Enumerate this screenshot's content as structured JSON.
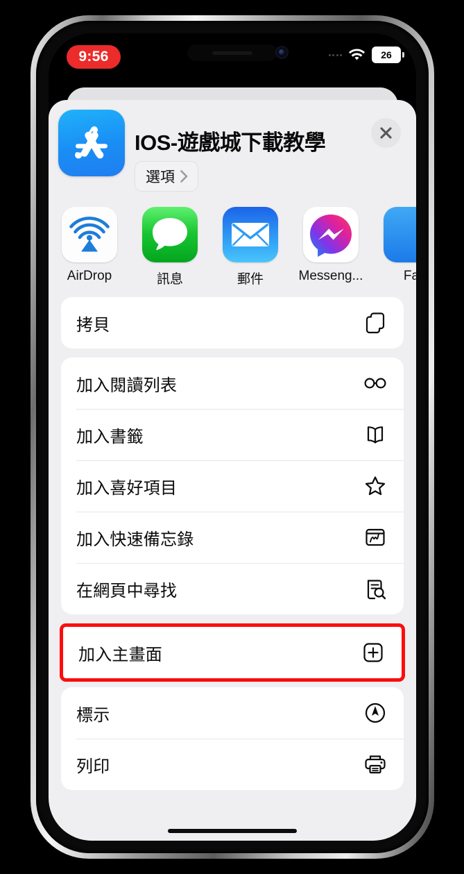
{
  "status_bar": {
    "time": "9:56",
    "battery_level": "26",
    "wifi_icon": "wifi-icon",
    "signal_icon": "signal-dots-icon",
    "clock_badge_color": "#ec2b2b"
  },
  "share_sheet": {
    "title": "IOS-遊戲城下載教學",
    "app_icon_name": "app-store-icon",
    "options_label": "選項",
    "options_chevron_icon": "chevron-right-icon",
    "close_icon": "close-icon",
    "apps": [
      {
        "label": "AirDrop",
        "icon": "airdrop-icon"
      },
      {
        "label": "訊息",
        "icon": "messages-icon"
      },
      {
        "label": "郵件",
        "icon": "mail-icon"
      },
      {
        "label": "Messeng...",
        "icon": "messenger-icon"
      },
      {
        "label": "Fa",
        "icon": "facetime-icon"
      }
    ],
    "action_groups": [
      {
        "rows": [
          {
            "label": "拷貝",
            "icon": "copy-icon",
            "highlighted": false
          }
        ]
      },
      {
        "rows": [
          {
            "label": "加入閱讀列表",
            "icon": "glasses-icon",
            "highlighted": false
          },
          {
            "label": "加入書籤",
            "icon": "book-icon",
            "highlighted": false
          },
          {
            "label": "加入喜好項目",
            "icon": "star-icon",
            "highlighted": false
          },
          {
            "label": "加入快速備忘錄",
            "icon": "quick-note-icon",
            "highlighted": false
          },
          {
            "label": "在網頁中尋找",
            "icon": "find-on-page-icon",
            "highlighted": false
          }
        ]
      },
      {
        "highlighted": true,
        "highlight_color": "#fc0d0d",
        "rows": [
          {
            "label": "加入主畫面",
            "icon": "plus-square-icon",
            "highlighted": true
          }
        ]
      },
      {
        "rows": [
          {
            "label": "標示",
            "icon": "markup-icon",
            "highlighted": false
          },
          {
            "label": "列印",
            "icon": "print-icon",
            "highlighted": false
          }
        ]
      }
    ]
  }
}
